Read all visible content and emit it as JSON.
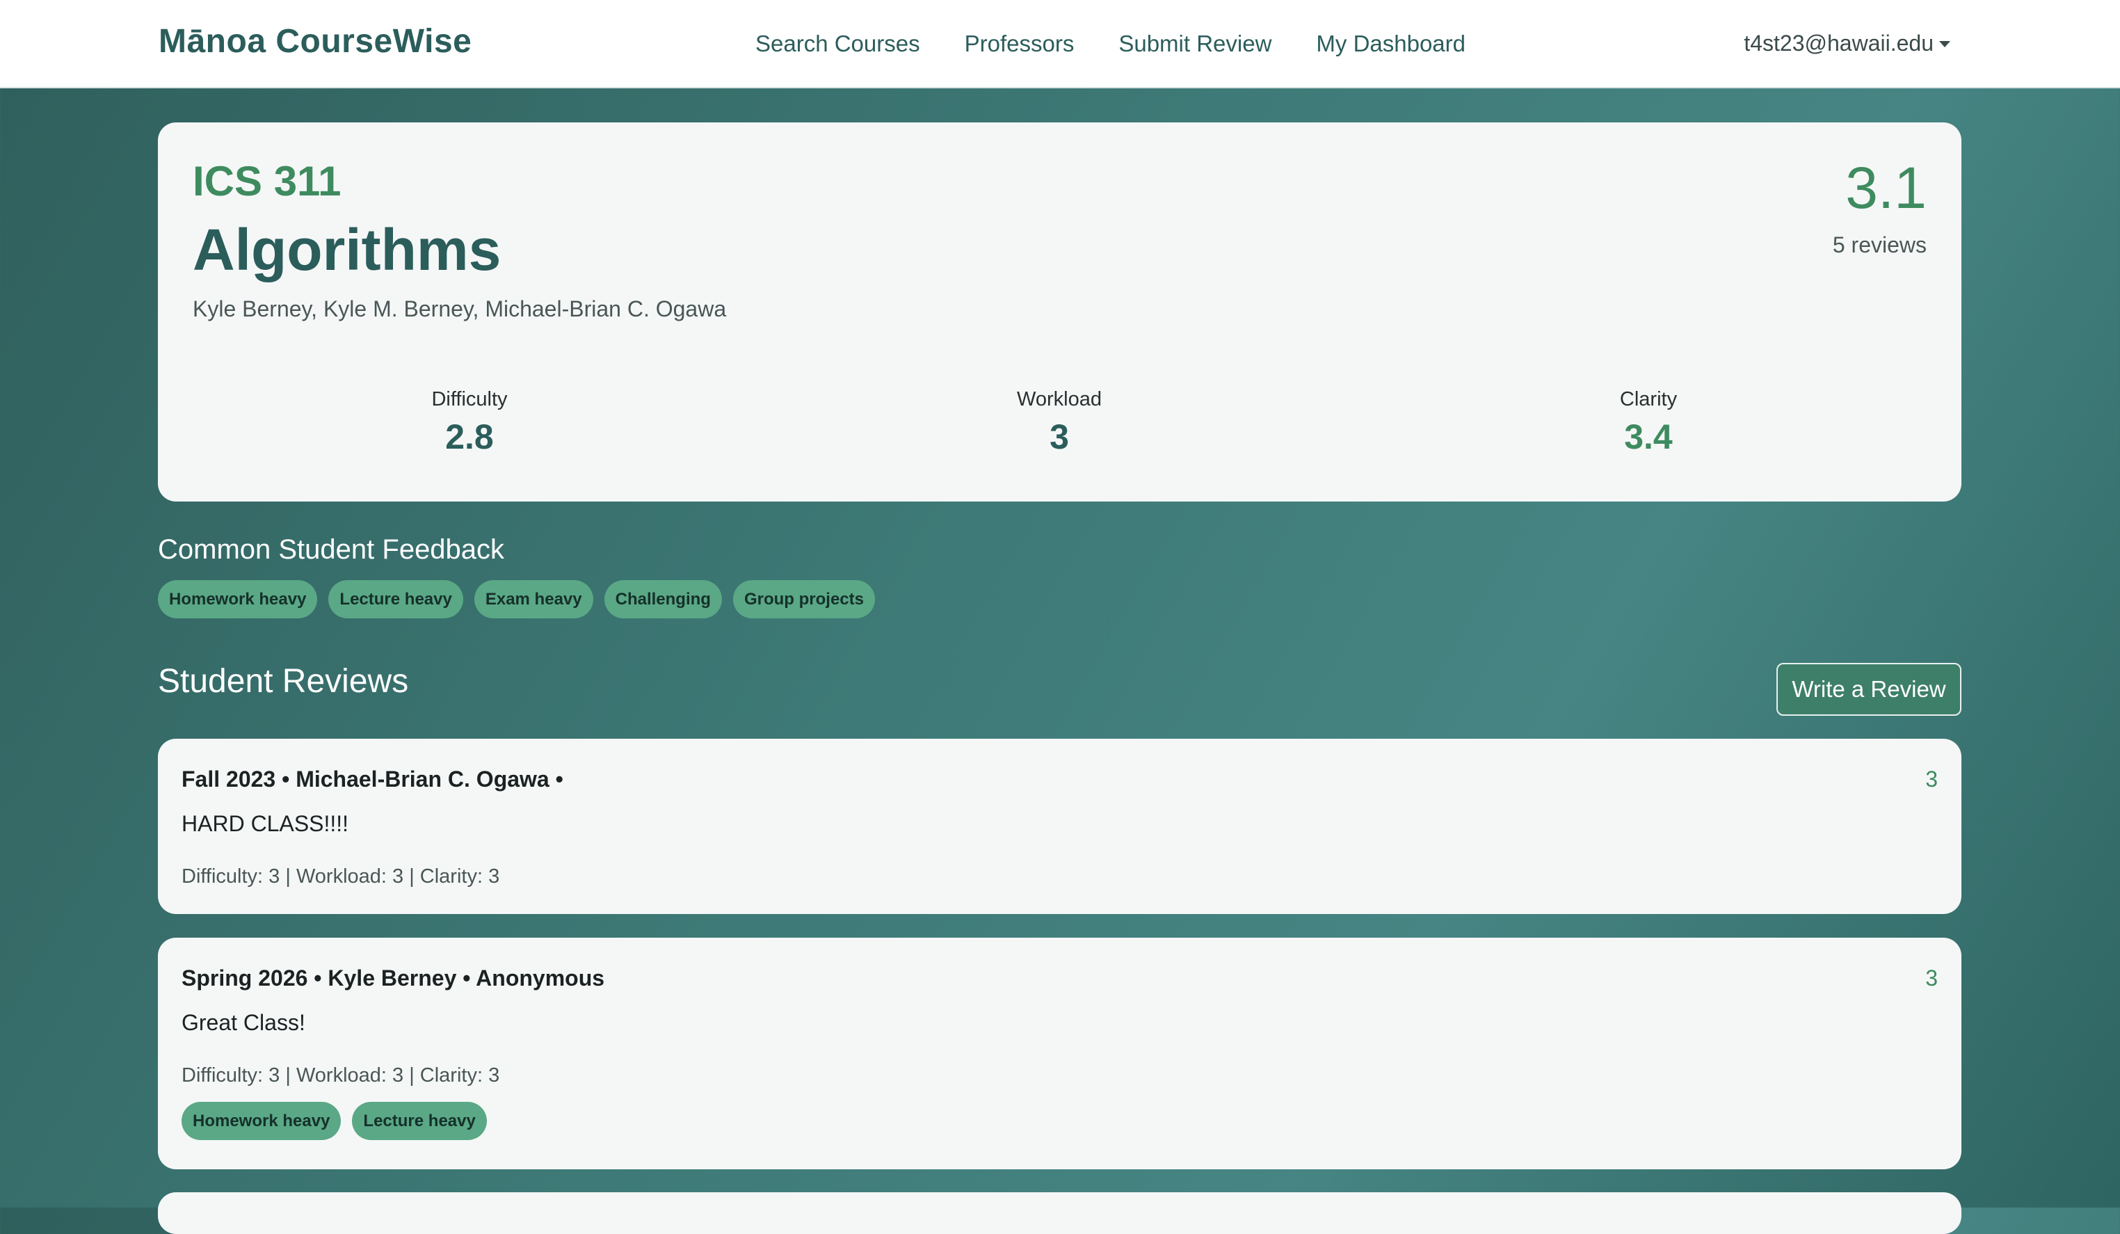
{
  "nav": {
    "brand": "Mānoa CourseWise",
    "links": [
      "Search Courses",
      "Professors",
      "Submit Review",
      "My Dashboard"
    ],
    "user": "t4st23@hawaii.edu"
  },
  "course": {
    "code": "ICS 311",
    "title": "Algorithms",
    "professors": "Kyle Berney, Kyle M. Berney, Michael-Brian C. Ogawa",
    "overall_rating": "3.1",
    "review_count": "5 reviews",
    "metrics": [
      {
        "label": "Difficulty",
        "value": "2.8",
        "color": "#2b5d5b"
      },
      {
        "label": "Workload",
        "value": "3",
        "color": "#2b5d5b"
      },
      {
        "label": "Clarity",
        "value": "3.4",
        "color": "#3e8b5f"
      }
    ]
  },
  "feedback": {
    "title": "Common Student Feedback",
    "tags": [
      "Homework heavy",
      "Lecture heavy",
      "Exam heavy",
      "Challenging",
      "Group projects"
    ]
  },
  "reviews": {
    "title": "Student Reviews",
    "write_button": "Write a Review",
    "items": [
      {
        "header": "Fall 2023 • Michael-Brian C. Ogawa •",
        "rating": "3",
        "text": "HARD CLASS!!!!",
        "stats": "Difficulty: 3 | Workload: 3 | Clarity: 3",
        "tags": []
      },
      {
        "header": "Spring 2026 • Kyle Berney • Anonymous",
        "rating": "3",
        "text": "Great Class!",
        "stats": "Difficulty: 3 | Workload: 3 | Clarity: 3",
        "tags": [
          "Homework heavy",
          "Lecture heavy"
        ]
      }
    ]
  }
}
